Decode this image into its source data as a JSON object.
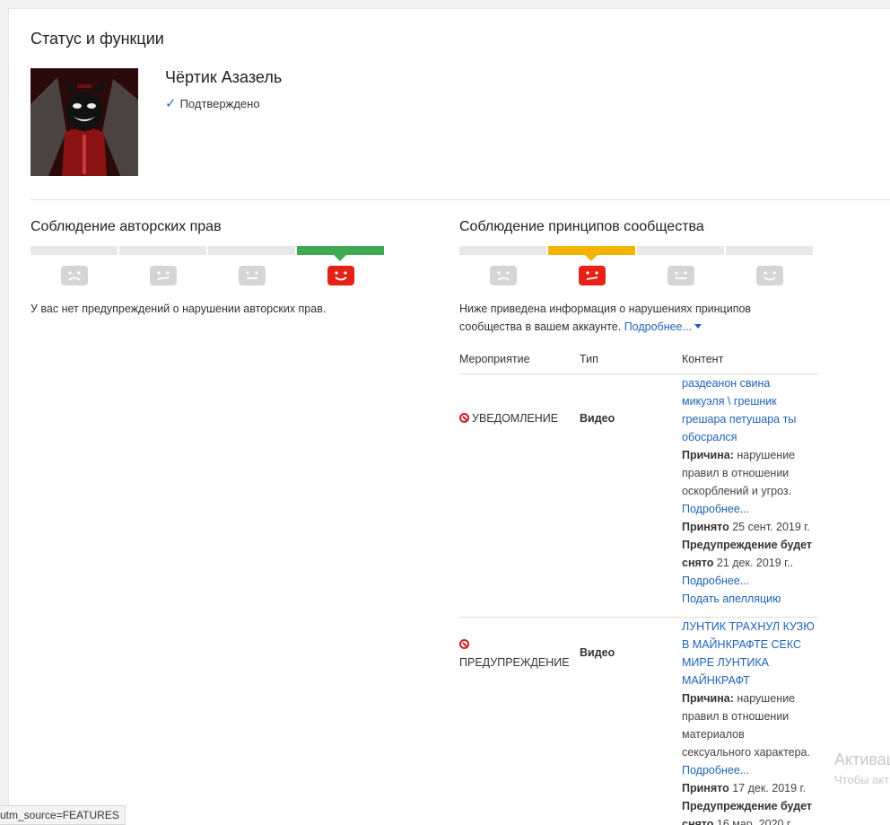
{
  "status_section": {
    "title": "Статус и функции"
  },
  "channel": {
    "name": "Чёртик Азазель",
    "verified_label": "Подтверждено"
  },
  "copyright": {
    "title": "Соблюдение авторских прав",
    "active_segment": 4,
    "message": "У вас нет предупреждений о нарушении авторских прав."
  },
  "community": {
    "title": "Соблюдение принципов сообщества",
    "active_segment": 2,
    "intro_line1": "Ниже приведена информация о нарушениях принципов",
    "intro_line2": "сообщества в вашем аккаунте.",
    "more_link": "Подробнее...",
    "table": {
      "headers": [
        "Мероприятие",
        "Тип",
        "Контент"
      ],
      "rows": [
        {
          "action": "УВЕДОМЛЕНИЕ",
          "type": "Видео",
          "title_lines": [
            "раздеанон свина",
            "микуэля \\ грешник",
            "грешара петушара ты",
            "обосрался"
          ],
          "reason_label": "Причина:",
          "reason_lines": [
            " нарушение",
            "правил в отношении",
            "оскорблений и угроз."
          ],
          "more_link": "Подробнее...",
          "accepted_label": "Принято",
          "accepted_date": " 25 сент. 2019 г.",
          "expiry_label_line1": "Предупреждение будет",
          "expiry_label_line2": "снято",
          "expiry_date": " 21 дек. 2019 г..",
          "more_link2": "Подробнее...",
          "appeal_link": "Подать апелляцию"
        },
        {
          "action": "ПРЕДУПРЕЖДЕНИЕ",
          "type": "Видео",
          "title_lines": [
            "ЛУНТИК ТРАХНУЛ КУЗЮ",
            "В МАЙНКРАФТЕ СЕКС",
            "МИРЕ ЛУНТИКА",
            "МАЙНКРАФТ"
          ],
          "reason_label": "Причина:",
          "reason_lines": [
            " нарушение",
            "правил в отношении",
            "материалов",
            "сексуального характера."
          ],
          "more_link": "Подробнее...",
          "accepted_label": "Принято",
          "accepted_date": " 17 дек. 2019 г.",
          "expiry_label_line1": "Предупреждение будет",
          "expiry_label_line2": "снято",
          "expiry_date": " 16 мар. 2020 г."
        }
      ]
    }
  },
  "status_bar": {
    "url_fragment": "utm_source=FEATURES"
  },
  "watermark": {
    "line1": "Активац",
    "line2": "Чтобы акт"
  },
  "colors": {
    "green": "#3eab52",
    "yellow": "#f4b400",
    "red": "#e62117",
    "link": "#1f63b5",
    "face_gray": "#d5d5d5"
  }
}
